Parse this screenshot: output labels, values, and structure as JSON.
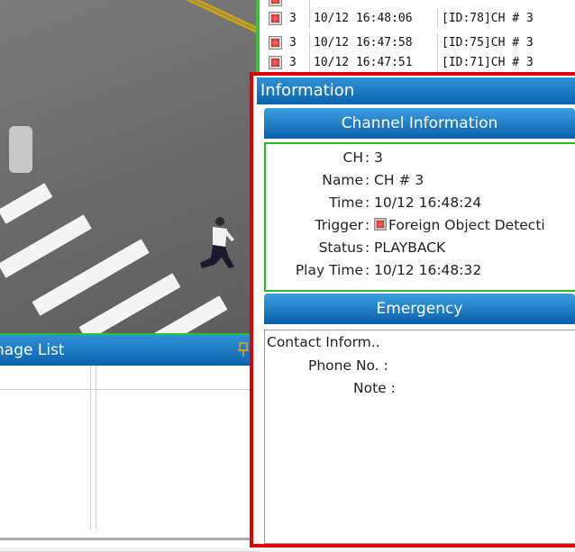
{
  "image_list": {
    "title": "nage List",
    "pin_icon": "pin-icon"
  },
  "events": [
    {
      "ch": "3",
      "time": "10/12 16:48:06",
      "desc": "[ID:78]CH # 3"
    },
    {
      "ch": "3",
      "time": "10/12 16:47:58",
      "desc": "[ID:75]CH # 3"
    },
    {
      "ch": "3",
      "time": "10/12 16:47:51",
      "desc": "[ID:71]CH # 3"
    }
  ],
  "info": {
    "title": "Information",
    "channel_section": "Channel Information",
    "fields": {
      "ch_label": "CH",
      "ch_value": "3",
      "name_label": "Name",
      "name_value": "CH # 3",
      "time_label": "Time",
      "time_value": "10/12 16:48:24",
      "trigger_label": "Trigger",
      "trigger_value": "Foreign Object Detecti",
      "status_label": "Status",
      "status_value": "PLAYBACK",
      "playtime_label": "Play Time",
      "playtime_value": "10/12 16:48:32"
    },
    "separator": ":",
    "emergency_section": "Emergency",
    "emergency": {
      "contact_label": "Contact Inform..",
      "phone_label": "Phone No. :",
      "note_label": "Note :"
    }
  },
  "colors": {
    "header_blue": "#0a63ad",
    "highlight_red": "#e00000",
    "border_green": "#29b829"
  }
}
